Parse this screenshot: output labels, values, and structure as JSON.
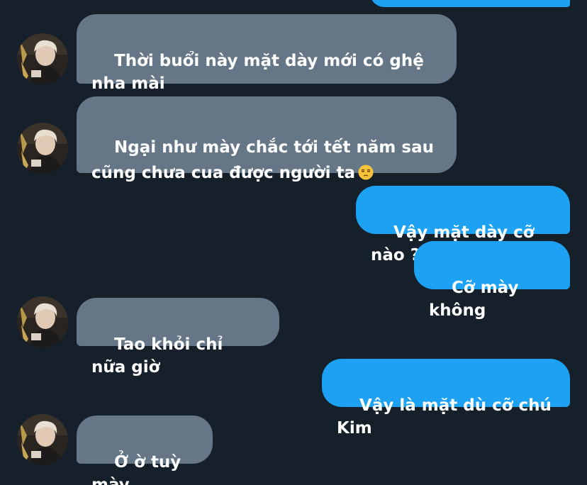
{
  "theme": {
    "background": "#15202b",
    "received_bubble": "#657786",
    "sent_bubble": "#1da1f2",
    "text": "#ffffff"
  },
  "messages": [
    {
      "direction": "sent",
      "text": ""
    },
    {
      "direction": "received",
      "text": "Thời buổi này mặt dày mới có ghệ nha mài",
      "avatar": "user-avatar"
    },
    {
      "direction": "received",
      "text": "Ngại như mày chắc tới tết năm sau cũng chưa cua được người ta",
      "emoji": "unamused-face-icon",
      "avatar": "user-avatar"
    },
    {
      "direction": "sent",
      "text": "Vậy mặt dày cỡ nào ?"
    },
    {
      "direction": "sent",
      "text": "Cỡ mày không"
    },
    {
      "direction": "received",
      "text": "Tao khỏi chỉ nữa giờ",
      "avatar": "user-avatar"
    },
    {
      "direction": "sent",
      "text": "Vậy là mặt dù cỡ chú Kim"
    },
    {
      "direction": "received",
      "text": "Ở ờ tuỳ mày",
      "avatar": "user-avatar"
    }
  ]
}
